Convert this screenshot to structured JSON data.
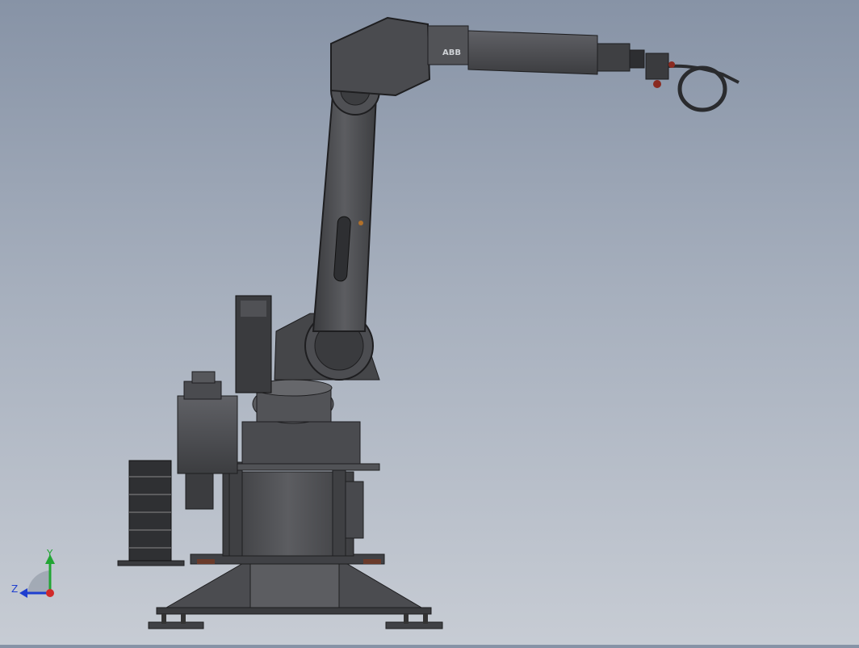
{
  "viewport": {
    "background_top": "#8793a6",
    "background_bottom": "#c7ccd4",
    "model": {
      "description_icon": "industrial-robot-arm-icon",
      "brand_label": "ABB"
    }
  },
  "triad": {
    "y_label": "Y",
    "z_label": "Z",
    "y_color": "#22a534",
    "z_color": "#1f3fcf",
    "x_color": "#d12a2a"
  }
}
